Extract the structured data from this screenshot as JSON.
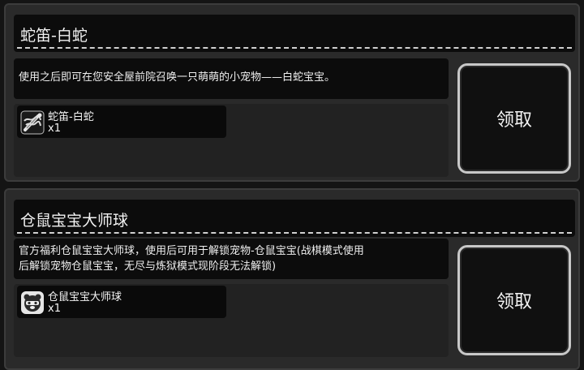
{
  "rewards": [
    {
      "title": "蛇笛-白蛇",
      "description_lines": [
        "使用之后即可在您安全屋前院召唤一只萌萌的小宠物——白蛇宝宝。"
      ],
      "item_name": "蛇笛-白蛇",
      "item_count": "x1",
      "item_icon": "snake-flute-icon",
      "claim_label": "领取"
    },
    {
      "title": "仓鼠宝宝大师球",
      "description_lines": [
        "官方福利仓鼠宝宝大师球，使用后可用于解锁宠物-仓鼠宝宝(战棋模式使用",
        "后解锁宠物仓鼠宝宝，无尽与炼狱模式现阶段无法解锁)"
      ],
      "item_name": "仓鼠宝宝大师球",
      "item_count": "x1",
      "item_icon": "hamster-ball-icon",
      "claim_label": "领取"
    }
  ]
}
